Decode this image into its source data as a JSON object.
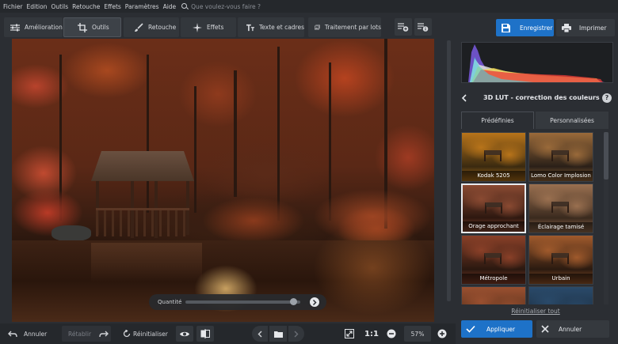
{
  "menu": {
    "items": [
      "Fichier",
      "Edition",
      "Outils",
      "Retouche",
      "Effets",
      "Paramètres",
      "Aide"
    ],
    "search_placeholder": "Que voulez-vous faire ?"
  },
  "toolbar": {
    "tabs": [
      {
        "label": "Amélioration",
        "icon": "sliders-icon"
      },
      {
        "label": "Outils",
        "icon": "crop-icon",
        "active": true
      },
      {
        "label": "Retouche",
        "icon": "brush-icon"
      },
      {
        "label": "Effets",
        "icon": "sparkle-icon"
      },
      {
        "label": "Texte et cadres",
        "icon": "text-icon"
      },
      {
        "label": "Traitement par lots",
        "icon": "batch-icon"
      }
    ],
    "save_label": "Enregistrer",
    "print_label": "Imprimer"
  },
  "quantity": {
    "label": "Quantité",
    "value": 0.97
  },
  "panel": {
    "title": "3D LUT - correction des couleurs",
    "help": "?",
    "tabs": [
      "Prédéfinies",
      "Personnalisées"
    ],
    "presets": [
      {
        "label": "Kodak 5205",
        "c1": "#b8741a",
        "c2": "#3a2a10"
      },
      {
        "label": "Lomo Color Implosion",
        "c1": "#9a6a3a",
        "c2": "#2a2018"
      },
      {
        "label": "Orage approchant",
        "c1": "#8a4a32",
        "c2": "#2e1810",
        "selected": true
      },
      {
        "label": "Éclairage tamisé",
        "c1": "#9a7050",
        "c2": "#3a2a1e"
      },
      {
        "label": "Métropole",
        "c1": "#8a4028",
        "c2": "#2a1810"
      },
      {
        "label": "Urbain",
        "c1": "#a05a2c",
        "c2": "#2a1a10"
      },
      {
        "label": "",
        "c1": "#9a5030",
        "c2": "#4a2a18"
      },
      {
        "label": "",
        "c1": "#2a4a6a",
        "c2": "#1a2a3a"
      }
    ],
    "reset_all": "Réinitialiser tout",
    "apply": "Appliquer",
    "cancel": "Annuler"
  },
  "bottom": {
    "undo": "Annuler",
    "redo": "Rétablir",
    "reset": "Réinitialiser",
    "actual_size": "1:1",
    "zoom": "57%"
  },
  "colors": {
    "accent": "#1e72c8",
    "bg": "#2b2e33",
    "bar": "#25282c"
  }
}
